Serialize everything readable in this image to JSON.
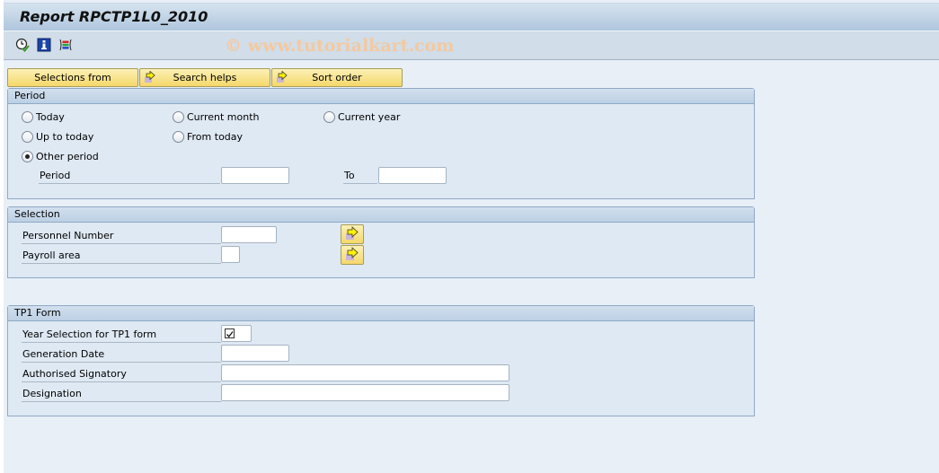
{
  "window": {
    "title": "Report RPCTP1L0_2010",
    "watermark": "© www.tutorialkart.com"
  },
  "toolbar": {
    "icons": [
      {
        "name": "execute-in-background-icon"
      },
      {
        "name": "program-documentation-icon"
      },
      {
        "name": "dynamic-selections-icon"
      }
    ]
  },
  "buttons": {
    "selections_from": "Selections from",
    "search_helps": "Search helps",
    "sort_order": "Sort order"
  },
  "period": {
    "title": "Period",
    "options": {
      "today": "Today",
      "current_month": "Current month",
      "current_year": "Current year",
      "up_to_today": "Up to today",
      "from_today": "From today",
      "other_period": "Other period"
    },
    "selected": "other_period",
    "period_label": "Period",
    "to_label": "To",
    "period_from_value": "",
    "period_to_value": ""
  },
  "selection": {
    "title": "Selection",
    "personnel_number_label": "Personnel Number",
    "personnel_number_value": "",
    "payroll_area_label": "Payroll area",
    "payroll_area_value": ""
  },
  "tp1form": {
    "title": "TP1 Form",
    "year_selection_label": "Year Selection for TP1 form",
    "year_selection_checked": true,
    "generation_date_label": "Generation Date",
    "generation_date_value": "",
    "authorised_signatory_label": "Authorised Signatory",
    "authorised_signatory_value": "",
    "designation_label": "Designation",
    "designation_value": ""
  }
}
